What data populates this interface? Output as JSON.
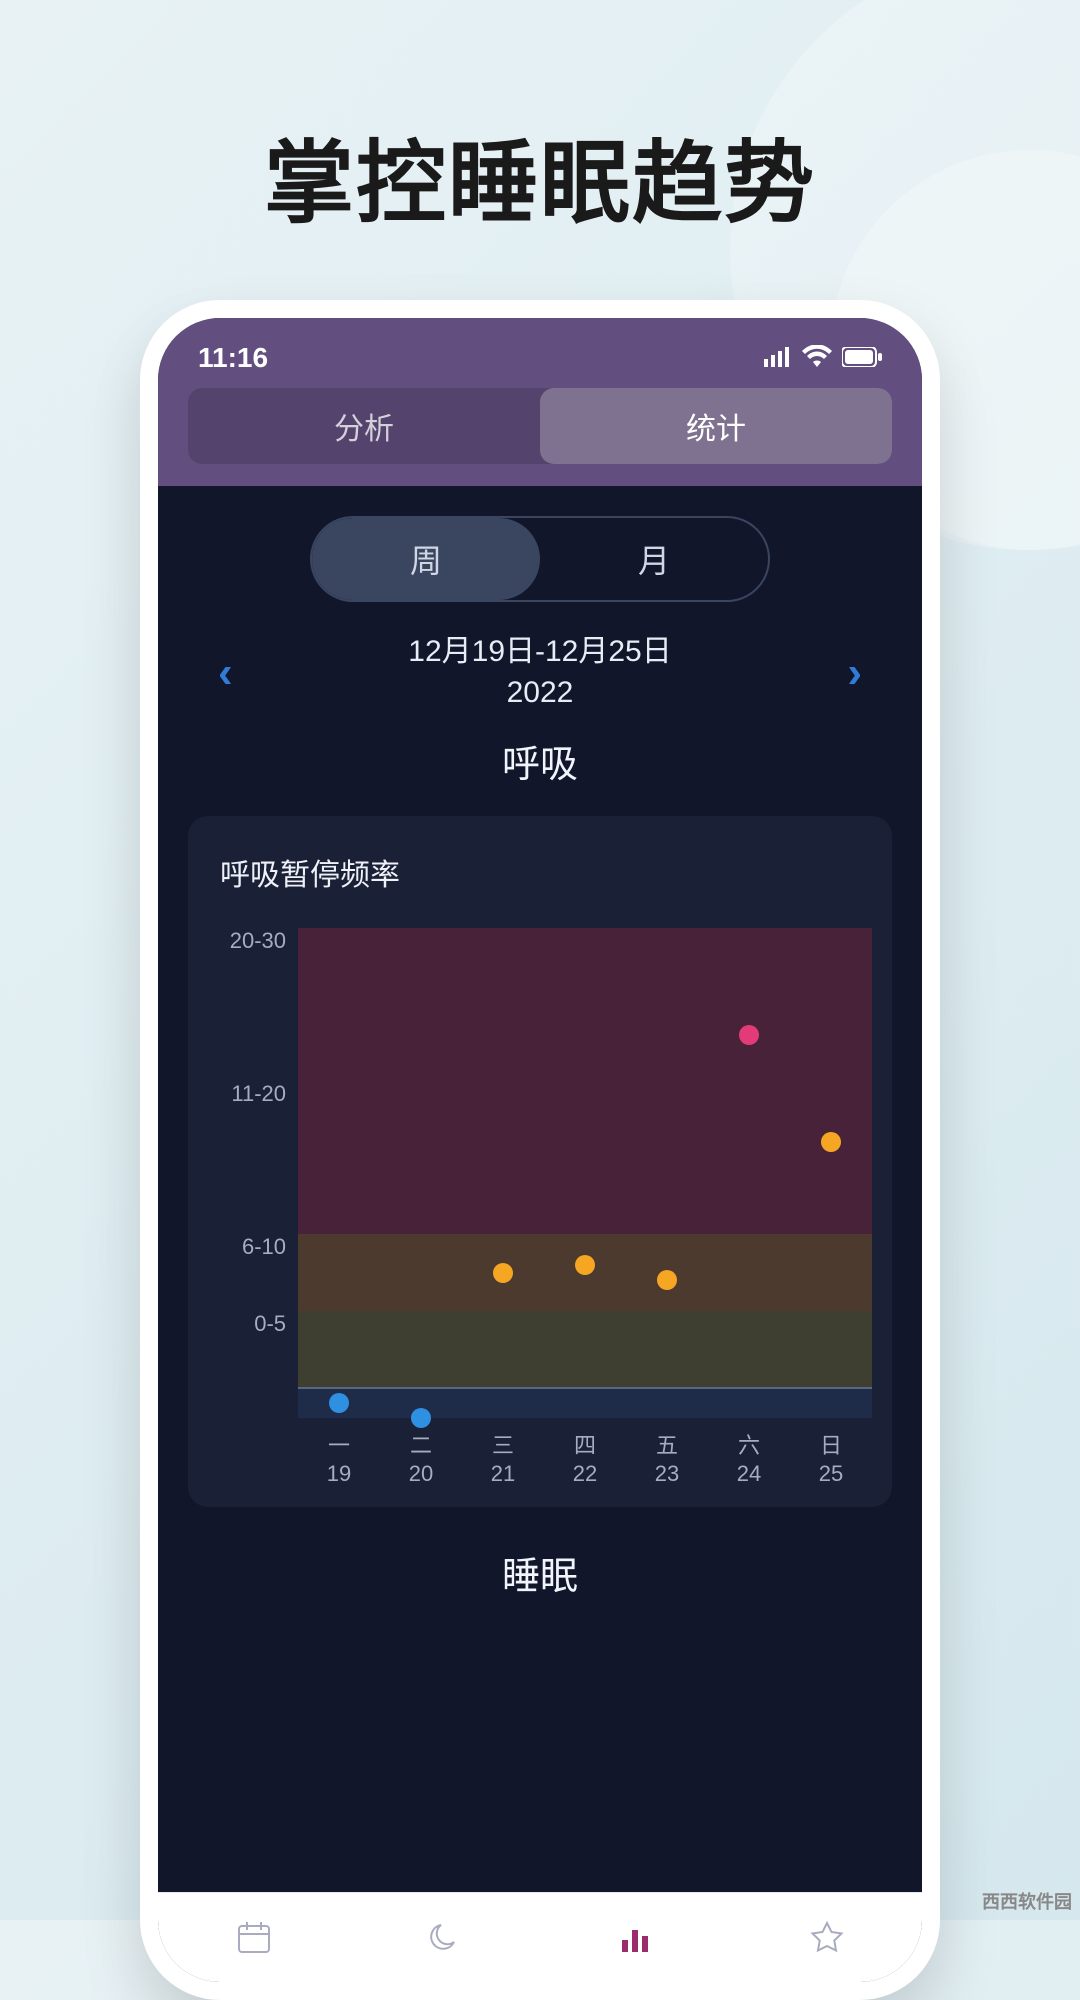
{
  "promo": {
    "title": "掌控睡眠趋势"
  },
  "status_bar": {
    "time": "11:16"
  },
  "top_tabs": {
    "items": [
      "分析",
      "统计"
    ],
    "active_index": 1
  },
  "period_toggle": {
    "items": [
      "周",
      "月"
    ],
    "active_index": 0
  },
  "date_range": {
    "line1": "12月19日-12月25日",
    "line2": "2022"
  },
  "section1_title": "呼吸",
  "card_title": "呼吸暂停频率",
  "section2_title": "睡眠",
  "watermark": "西西软件园",
  "chart_data": {
    "type": "scatter",
    "title": "呼吸暂停频率",
    "xlabel": "",
    "ylabel": "",
    "y_ticks": [
      "20-30",
      "11-20",
      "6-10",
      "0-5"
    ],
    "y_numeric_range": [
      -2,
      30
    ],
    "bands": [
      {
        "name": "red",
        "range": [
          10,
          30
        ]
      },
      {
        "name": "orange",
        "range": [
          5,
          10
        ]
      },
      {
        "name": "yellow",
        "range": [
          0,
          5
        ]
      },
      {
        "name": "blue",
        "range": [
          -2,
          0
        ]
      }
    ],
    "x_ticks": [
      {
        "dow": "一",
        "day": "19"
      },
      {
        "dow": "二",
        "day": "20"
      },
      {
        "dow": "三",
        "day": "21"
      },
      {
        "dow": "四",
        "day": "22"
      },
      {
        "dow": "五",
        "day": "23"
      },
      {
        "dow": "六",
        "day": "24"
      },
      {
        "dow": "日",
        "day": "25"
      }
    ],
    "points": [
      {
        "xi": 0,
        "y": -1.0,
        "color": "blue"
      },
      {
        "xi": 1,
        "y": -2.0,
        "color": "blue"
      },
      {
        "xi": 2,
        "y": 7.5,
        "color": "orange"
      },
      {
        "xi": 3,
        "y": 8.0,
        "color": "orange"
      },
      {
        "xi": 4,
        "y": 7.0,
        "color": "orange"
      },
      {
        "xi": 5,
        "y": 23.0,
        "color": "pink"
      },
      {
        "xi": 6,
        "y": 16.0,
        "color": "orange"
      }
    ]
  }
}
